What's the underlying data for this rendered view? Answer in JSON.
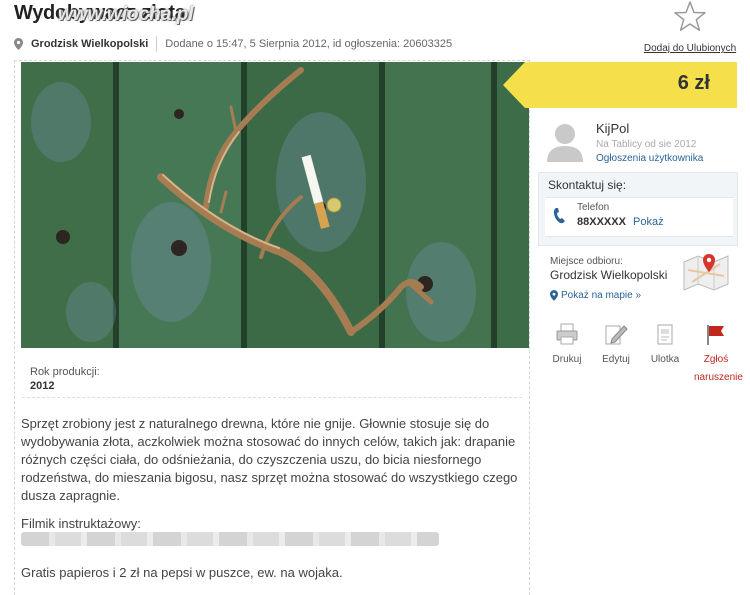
{
  "listing": {
    "title": "Wydobywacz złota",
    "watermark": "www.wiocha.pl",
    "city": "Grodzisk Wielkopolski",
    "posted_info": "Dodane o 15:47, 5 Sierpnia 2012, id ogłoszenia: 20603325",
    "favorite_label": "Dodaj do Ulubionych"
  },
  "params": {
    "year_label": "Rok produkcji:",
    "year_value": "2012"
  },
  "description": {
    "body": "Sprzęt zrobiony jest z naturalnego drewna, które nie gnije. Głownie stosuje się do wydobywania złota, aczkolwiek można stosować do innych celów, takich jak: drapanie różnych części ciała, do odśnieżania, do czyszczenia uszu, do bicia niesfornego rodzeństwa, do mieszania bigosu, nasz sprzęt można stosować do wszystkiego czego dusza zapragnie.",
    "video_label": "Filmik instruktażowy:",
    "gratis": "Gratis papieros i 2 zł na pepsi w puszce, ew. na wojaka."
  },
  "price": {
    "value": "6 zł",
    "accent": "#f5e04c"
  },
  "seller": {
    "name": "KijPol",
    "since": "Na Tablicy od sie 2012",
    "ads_link": "Ogłoszenia użytkownika"
  },
  "contact": {
    "title": "Skontaktuj się:",
    "phone_label": "Telefon",
    "phone_number": "88XXXXX",
    "phone_show": "Pokaż",
    "pickup_label": "Miejsce odbioru:",
    "pickup_city": "Grodzisk Wielkopolski",
    "map_link": "Pokaż na mapie »"
  },
  "actions": [
    {
      "label": "Drukuj",
      "icon": "printer-icon"
    },
    {
      "label": "Edytuj",
      "icon": "edit-icon"
    },
    {
      "label": "Ulotka",
      "icon": "flyer-icon"
    },
    {
      "label": "Zgłoś naruszenie",
      "icon": "flag-icon"
    }
  ],
  "colors": {
    "link": "#2a6496",
    "report": "#c0281c",
    "bench_green": "#3e6d47"
  }
}
